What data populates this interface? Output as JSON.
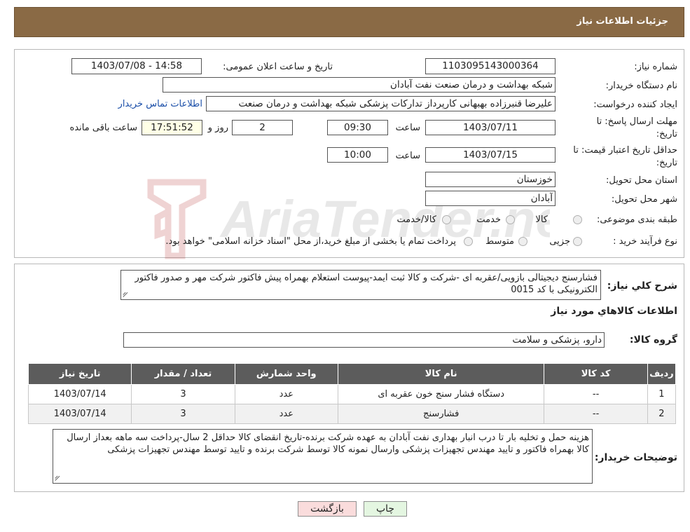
{
  "header": {
    "title": "جزئیات اطلاعات نیاز"
  },
  "watermark": {
    "text": "AriaTender.neT"
  },
  "need": {
    "number_label": "شماره نیاز:",
    "number_value": "1103095143000364",
    "announce_label": "تاریخ و ساعت اعلان عمومی:",
    "announce_value": "1403/07/08 - 14:58",
    "buyer_label": "نام دستگاه خریدار:",
    "buyer_value": "شبکه بهداشت و درمان صنعت نفت آبادان",
    "creator_label": "ایجاد کننده درخواست:",
    "creator_value": "علیرضا قنبرزاده بهبهانی کارپرداز تدارکات پزشکی شبکه بهداشت و درمان صنعت",
    "contact_link": "اطلاعات تماس خریدار",
    "deadline_label_1": "مهلت ارسال پاسخ: تا",
    "deadline_label_2": "تاریخ:",
    "deadline_date": "1403/07/11",
    "time_label": "ساعت",
    "deadline_time": "09:30",
    "days_value": "2",
    "days_label": "روز و",
    "remaining_time": "17:51:52",
    "remaining_label": "ساعت باقی مانده",
    "validity_label_1": "حداقل تاریخ اعتبار قیمت: تا",
    "validity_label_2": "تاریخ:",
    "validity_date": "1403/07/15",
    "validity_time_label": "ساعت",
    "validity_time": "10:00",
    "province_label": "استان محل تحویل:",
    "province_value": "خوزستان",
    "city_label": "شهر محل تحویل:",
    "city_value": "آبادان",
    "category_label": "طبقه بندی موضوعی:",
    "category_options": [
      "کالا",
      "خدمت",
      "کالا/خدمت"
    ],
    "process_label": "نوع فرآیند خرید :",
    "process_options": [
      "جزیی",
      "متوسط"
    ],
    "process_note": "پرداخت تمام یا بخشی از مبلغ خرید،از محل \"اسناد خزانه اسلامی\" خواهد بود."
  },
  "details": {
    "description_label": "شرح کلي نياز:",
    "description_value": "فشارسنج دیجیتالی بازویی/عقربه ای -شرکت و کالا ثبت ایمد-پیوست استعلام بهمراه پیش فاکتور شرکت مهر و صدور فاکتور الکترونیکی با کد 0015",
    "goods_info_title": "اطلاعات کالاهاي مورد نياز",
    "goods_group_label": "گروه کالا:",
    "goods_group_value": "دارو، پزشکی و سلامت",
    "table": {
      "headers": [
        "ردیف",
        "کد کالا",
        "نام کالا",
        "واحد شمارش",
        "تعداد / مقدار",
        "تاریخ نیاز"
      ],
      "rows": [
        [
          "1",
          "--",
          "دستگاه فشار سنج خون عقربه ای",
          "عدد",
          "3",
          "1403/07/14"
        ],
        [
          "2",
          "--",
          "فشارسنج",
          "عدد",
          "3",
          "1403/07/14"
        ]
      ]
    },
    "buyer_notes_label": "توضیحات خریدار:",
    "buyer_notes_value": "هزینه حمل و تخلیه بار تا درب انبار بهداری نفت آبادان به عهده شرکت برنده-تاریخ انقضای کالا حداقل 2 سال-پرداخت سه ماهه بعداز ارسال کالا بهمراه فاکتور و تایید مهندس تجهیزات پزشکی وارسال نمونه کالا توسط شرکت برنده و تایید توسط مهندس تجهیزات پزشکی"
  },
  "buttons": {
    "print": "چاپ",
    "back": "بازگشت"
  },
  "colors": {
    "header_bg": "#8a6a45",
    "table_header_bg": "#5c5c5c",
    "back_button_bg": "#fadcdc",
    "print_button_bg": "#e4f6e1"
  }
}
